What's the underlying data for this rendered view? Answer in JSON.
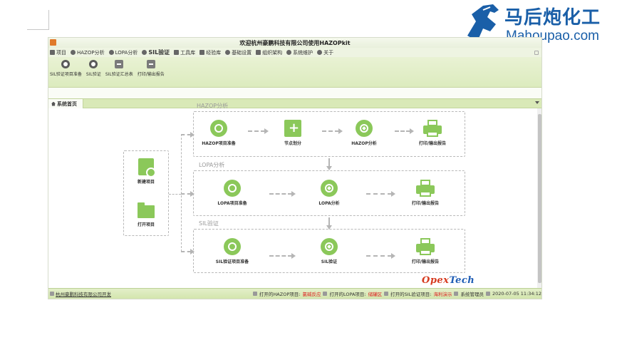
{
  "watermark": {
    "brand": "马后炮化工",
    "url": "Mahoupao.com"
  },
  "window": {
    "title": "欢迎杭州豪鹏科技有限公司使用HAZOPkit"
  },
  "menu": [
    {
      "label": "项目",
      "icon": "grid-icon"
    },
    {
      "label": "HAZOP分析",
      "icon": "circle-icon"
    },
    {
      "label": "LOPA分析",
      "icon": "circle-icon"
    },
    {
      "label": "SIL验证",
      "icon": "circle-icon",
      "active": true
    },
    {
      "label": "工具库",
      "icon": "toolbox-icon"
    },
    {
      "label": "经验库",
      "icon": "list-icon"
    },
    {
      "label": "基础设置",
      "icon": "gear-icon"
    },
    {
      "label": "组织架构",
      "icon": "org-icon"
    },
    {
      "label": "系统维护",
      "icon": "gear-icon"
    },
    {
      "label": "关于",
      "icon": "info-icon"
    }
  ],
  "toolbar": [
    {
      "label": "SIL验证项目准备",
      "icon": "target-icon"
    },
    {
      "label": "SIL验证",
      "icon": "chat-icon"
    },
    {
      "label": "SIL验证汇总表",
      "icon": "report-icon"
    },
    {
      "label": "打印/输出报告",
      "icon": "printer-icon"
    }
  ],
  "tab": {
    "label": "系统首页"
  },
  "diagram": {
    "groups": {
      "hazop": "HAZOP分析",
      "lopa": "LOPA分析",
      "sil": "SIL验证"
    },
    "left": {
      "new": "新建项目",
      "open": "打开项目"
    },
    "hazop_nodes": [
      "HAZOP项目准备",
      "节点划分",
      "HAZOP分析",
      "打印/输出报告"
    ],
    "lopa_nodes": [
      "LOPA项目准备",
      "LOPA分析",
      "打印/输出报告"
    ],
    "sil_nodes": [
      "SIL验证项目准备",
      "SIL验证",
      "打印/输出报告"
    ],
    "logo": {
      "part1": "Opex",
      "part2": "Tech"
    }
  },
  "status": {
    "company": "杭州豪鹏科技有限公司开发",
    "hazop_label": "打开的HAZOP项目:",
    "hazop_value": "氯碱反应",
    "lopa_label": "打开的LOPA项目:",
    "lopa_value": "储罐区",
    "sil_label": "打开的SIL验证项目:",
    "sil_value": "海利演示",
    "user": "系统管理员",
    "datetime": "2020-07-05 11:34:12"
  },
  "colors": {
    "accent_green": "#8bc85a",
    "toolbar_green": "#dcebbe",
    "status_red": "#dd2222",
    "brand_blue": "#1a5fa8"
  }
}
